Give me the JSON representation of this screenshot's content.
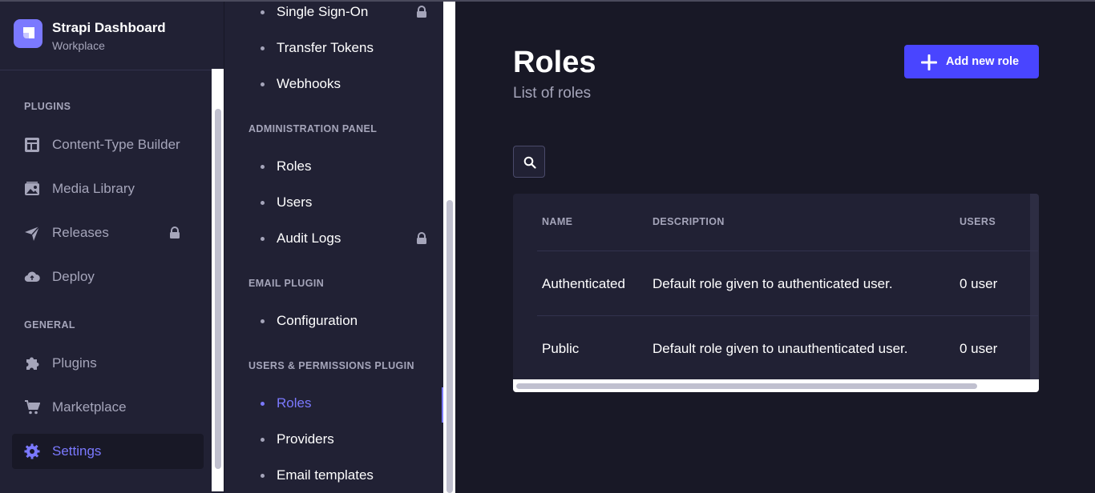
{
  "app": {
    "title": "Strapi Dashboard",
    "subtitle": "Workplace"
  },
  "mainnav": {
    "sections": [
      {
        "label": "PLUGINS",
        "items": [
          {
            "label": "Content-Type Builder",
            "icon": "layout-icon"
          },
          {
            "label": "Media Library",
            "icon": "image-icon"
          },
          {
            "label": "Releases",
            "icon": "paper-plane-icon",
            "locked": true
          },
          {
            "label": "Deploy",
            "icon": "cloud-icon"
          }
        ]
      },
      {
        "label": "GENERAL",
        "items": [
          {
            "label": "Plugins",
            "icon": "puzzle-icon"
          },
          {
            "label": "Marketplace",
            "icon": "cart-icon"
          },
          {
            "label": "Settings",
            "icon": "gear-icon",
            "active": true
          }
        ]
      }
    ]
  },
  "subnav": {
    "top_items": [
      "Single Sign-On",
      "Transfer Tokens",
      "Webhooks"
    ],
    "sections": [
      {
        "label": "ADMINISTRATION PANEL",
        "items": [
          "Roles",
          "Users",
          "Audit Logs"
        ]
      },
      {
        "label": "EMAIL PLUGIN",
        "items": [
          "Configuration"
        ]
      },
      {
        "label": "USERS & PERMISSIONS PLUGIN",
        "items": [
          "Roles",
          "Providers",
          "Email templates"
        ]
      }
    ]
  },
  "page": {
    "title": "Roles",
    "subtitle": "List of roles",
    "add_button": "Add new role"
  },
  "table": {
    "headers": [
      "NAME",
      "DESCRIPTION",
      "USERS"
    ],
    "rows": [
      {
        "name": "Authenticated",
        "description": "Default role given to authenticated user.",
        "users": "0 user"
      },
      {
        "name": "Public",
        "description": "Default role given to unauthenticated user.",
        "users": "0 user"
      }
    ]
  },
  "colors": {
    "accent": "#4945ff",
    "accent_light": "#7b79ff",
    "background": "#181826",
    "panel": "#212134",
    "muted_text": "#a5a5ba"
  }
}
